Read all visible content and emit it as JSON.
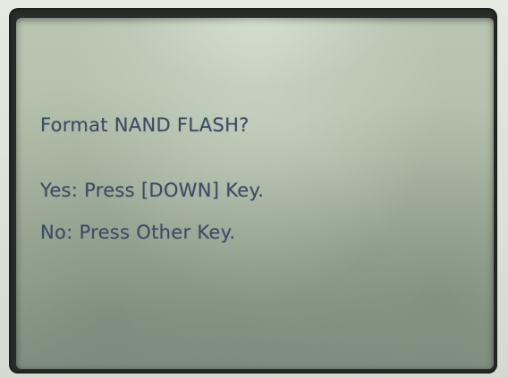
{
  "lcd": {
    "title_line": "Format NAND FLASH?",
    "yes_line": "Yes: Press [DOWN] Key.",
    "no_line": "No: Press Other Key."
  }
}
